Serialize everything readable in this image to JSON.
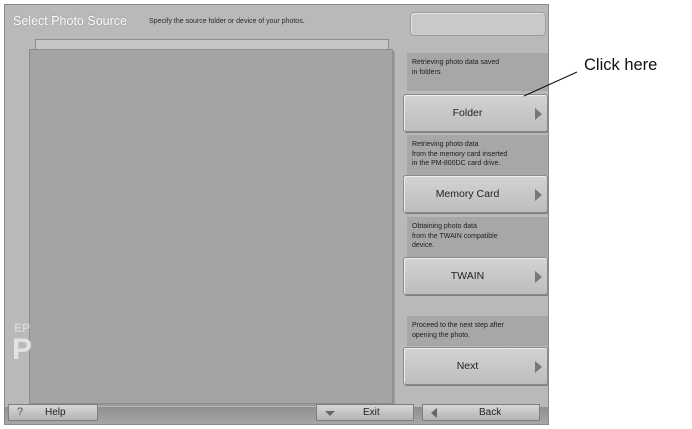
{
  "window": {
    "title": "Select Photo Source",
    "subtitle": "Specify the source folder or device of your photos."
  },
  "watermark": {
    "ep": "EP",
    "p": "P"
  },
  "sources": [
    {
      "description": "Retrieving photo data saved\nin folders.",
      "button": "Folder"
    },
    {
      "description": "Retrieving photo data\nfrom the memory card inserted\nin the PM-800DC card drive.",
      "button": "Memory Card"
    },
    {
      "description": "Obtaining photo data\nfrom the TWAIN compatible\ndevice.",
      "button": "TWAIN"
    },
    {
      "description": "Proceed to the next step after\nopening the photo.",
      "button": "Next"
    }
  ],
  "bottom": {
    "help_icon": "?",
    "help": "Help",
    "exit": "Exit",
    "back": "Back"
  },
  "callout": {
    "text": "Click here"
  },
  "icons": {
    "next_arrows": "arrow-right-icon",
    "exit_arrow": "arrow-down-icon",
    "back_arrow": "arrow-left-icon",
    "help": "question-icon"
  },
  "colors": {
    "window_background": "#b9b9b9",
    "photo_area": "#a4a4a4",
    "button_face": "#cacaca"
  }
}
